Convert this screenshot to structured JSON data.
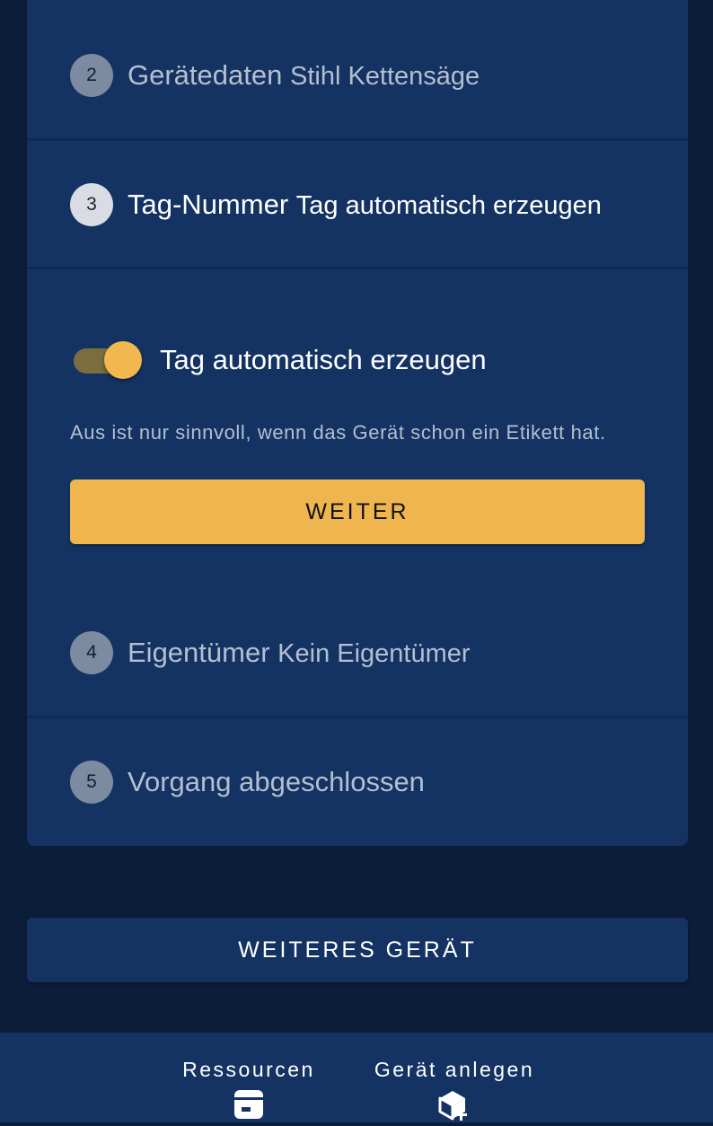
{
  "steps": [
    {
      "number": "2",
      "title": "Gerätedaten",
      "subtitle": "Stihl Kettensäge"
    },
    {
      "number": "3",
      "title": "Tag-Nummer",
      "subtitle": "Tag automatisch erzeugen"
    },
    {
      "number": "4",
      "title": "Eigentümer",
      "subtitle": "Kein Eigentümer"
    },
    {
      "number": "5",
      "title": "Vorgang abgeschlossen",
      "subtitle": ""
    }
  ],
  "active_step": {
    "toggle_label": "Tag automatisch erzeugen",
    "toggle_on": true,
    "hint": "Aus ist nur sinnvoll, wenn das Gerät schon ein Etikett hat.",
    "next_button": "WEITER"
  },
  "more_button": "WEITERES GERÄT",
  "bottom_nav": [
    {
      "label": "Ressourcen",
      "icon": "resource-box-icon"
    },
    {
      "label": "Gerät anlegen",
      "icon": "add-device-icon"
    }
  ],
  "colors": {
    "background": "#0c1d3a",
    "card": "#143363",
    "accent": "#efb54f"
  }
}
